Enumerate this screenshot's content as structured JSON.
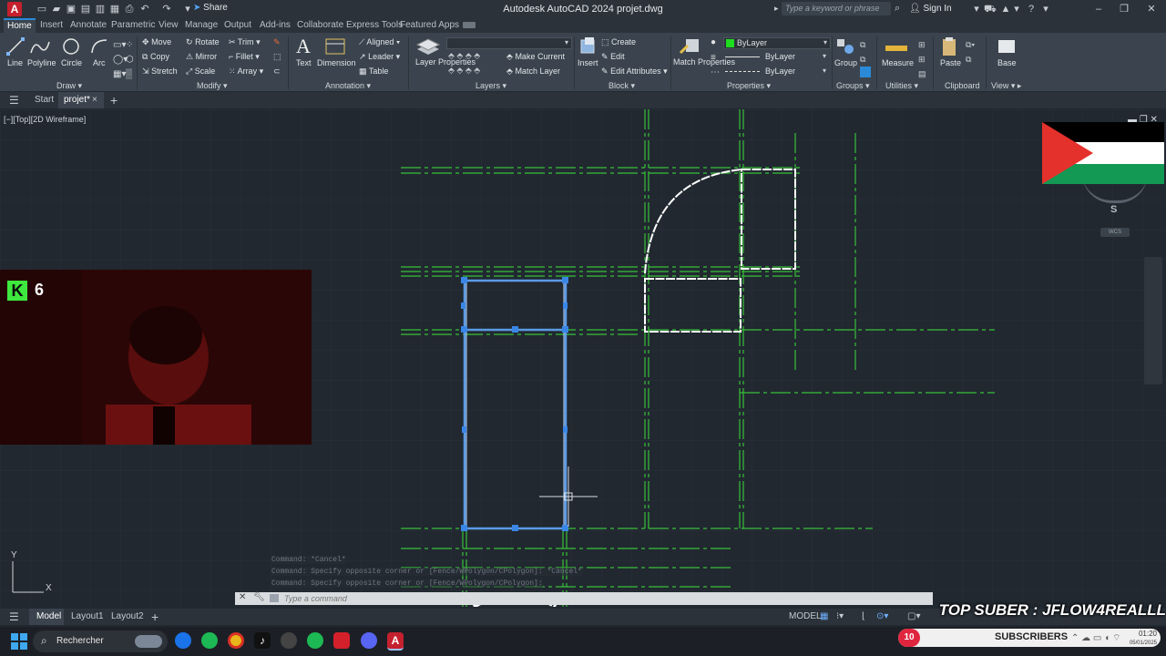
{
  "app": {
    "logo_letter": "A",
    "window_title": "Autodesk AutoCAD 2024   projet.dwg",
    "share_label": "Share",
    "search_placeholder": "Type a keyword or phrase",
    "sign_in": "Sign In"
  },
  "ribbon_tabs": [
    "Home",
    "Insert",
    "Annotate",
    "Parametric",
    "View",
    "Manage",
    "Output",
    "Add-ins",
    "Collaborate",
    "Express Tools",
    "Featured Apps"
  ],
  "ribbon": {
    "draw": {
      "title": "Draw",
      "line": "Line",
      "polyline": "Polyline",
      "circle": "Circle",
      "arc": "Arc"
    },
    "modify": {
      "title": "Modify",
      "move": "Move",
      "rotate": "Rotate",
      "trim": "Trim",
      "copy": "Copy",
      "mirror": "Mirror",
      "fillet": "Fillet",
      "stretch": "Stretch",
      "scale": "Scale",
      "array": "Array"
    },
    "annotation": {
      "title": "Annotation",
      "text": "Text",
      "dimension": "Dimension",
      "aligned": "Aligned",
      "leader": "Leader",
      "table": "Table"
    },
    "layers": {
      "title": "Layers",
      "layer_properties": "Layer Properties",
      "make_current": "Make Current",
      "match_layer": "Match Layer"
    },
    "block": {
      "title": "Block",
      "insert": "Insert",
      "create": "Create",
      "edit": "Edit",
      "edit_attributes": "Edit Attributes"
    },
    "properties": {
      "title": "Properties",
      "match_properties": "Match Properties",
      "bylayer_color": "ByLayer",
      "bylayer_linetype": "ByLayer",
      "bylayer_lineweight": "ByLayer"
    },
    "groups": {
      "title": "Groups",
      "group": "Group"
    },
    "utilities": {
      "title": "Utilities",
      "measure": "Measure"
    },
    "clipboard": {
      "title": "Clipboard",
      "paste": "Paste"
    },
    "view": {
      "title": "View",
      "base": "Base"
    }
  },
  "file_tabs": {
    "start": "Start",
    "projet": "projet*"
  },
  "viewport_label": "[−][Top][2D Wireframe]",
  "viewcube": {
    "south": "S",
    "wcs": "WCS"
  },
  "ucs": {
    "y": "Y",
    "x": "X"
  },
  "webcam": {
    "badge_letter": "K",
    "badge_number": "6"
  },
  "command": {
    "history": [
      "Command: *Cancel*",
      "Command: Specify opposite corner or [Fence/WPolygon/CPolygon]: *Cancel*",
      "Command: Specify opposite corner or [Fence/WPolygon/CPolygon]:"
    ],
    "placeholder": "Type a command"
  },
  "layout_tabs": [
    "Model",
    "Layout1",
    "Layout2"
  ],
  "status": {
    "model": "MODEL"
  },
  "overlay": {
    "top_suber": "TOP SUBER : JFLOW4REALLL",
    "subs_count": "10",
    "subs_label": "SUBSCRIBERS",
    "clock_time": "01:20",
    "clock_date": "05/01/2025"
  },
  "taskbar": {
    "search_label": "Rechercher"
  },
  "colors": {
    "accent": "#2a8ad8",
    "green_lines": "#38c038",
    "selection": "#5b9be6",
    "autocad_red": "#c5202e"
  }
}
